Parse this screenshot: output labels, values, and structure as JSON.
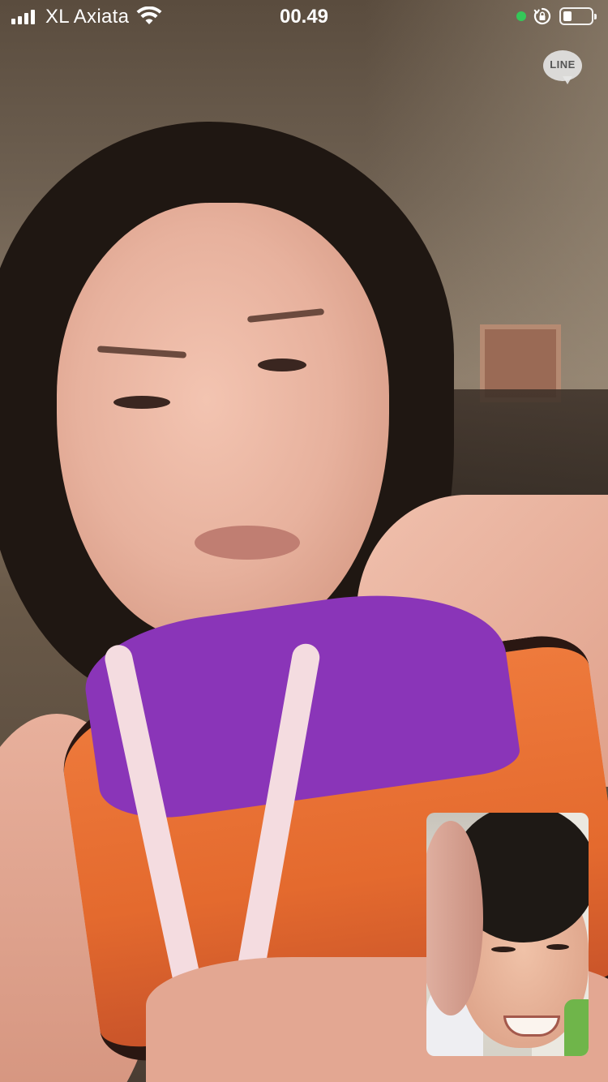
{
  "status_bar": {
    "carrier": "XL Axiata",
    "time": "00.49",
    "signal_bars": 4,
    "camera_indicator_color": "#34c759",
    "battery_level": 0.3
  },
  "app": {
    "watermark": "LINE"
  },
  "icons": {
    "signal": "cellular-signal-icon",
    "wifi": "wifi-icon",
    "camera_indicator": "camera-in-use-dot",
    "rotation_lock": "rotation-lock-icon",
    "battery": "battery-icon",
    "app_logo": "line-logo-icon"
  }
}
